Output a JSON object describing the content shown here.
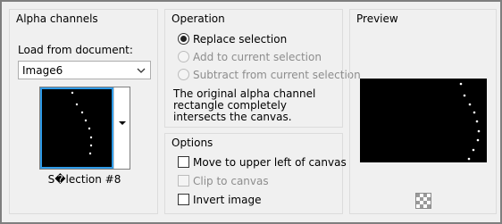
{
  "alpha_channels": {
    "title": "Alpha channels",
    "load_label": "Load from document:",
    "document_value": "Image6",
    "selection_caption": "S�lection #8"
  },
  "operation": {
    "title": "Operation",
    "options": [
      {
        "label": "Replace selection",
        "selected": true,
        "enabled": true
      },
      {
        "label": "Add to current selection",
        "selected": false,
        "enabled": false
      },
      {
        "label": "Subtract from current selection",
        "selected": false,
        "enabled": false
      }
    ],
    "description": "The original alpha channel rectangle completely intersects the canvas."
  },
  "options": {
    "title": "Options",
    "items": [
      {
        "label": "Move to upper left of canvas",
        "checked": false,
        "enabled": true
      },
      {
        "label": "Clip to canvas",
        "checked": false,
        "enabled": false
      },
      {
        "label": "Invert image",
        "checked": false,
        "enabled": true
      }
    ]
  },
  "preview": {
    "title": "Preview",
    "transparency_icon": "checkerboard-icon"
  },
  "colors": {
    "selection_highlight": "#2f9be8",
    "canvas": "#000000",
    "dot": "#ffffff"
  }
}
